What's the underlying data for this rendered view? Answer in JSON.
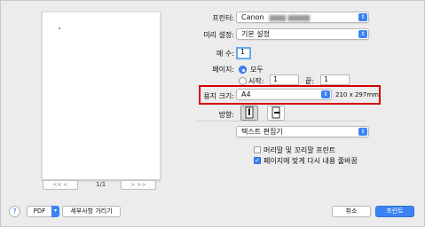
{
  "preview": {
    "page_count": "1/1"
  },
  "printer": {
    "label": "프린터:",
    "value": "Canon",
    "value_model_blurred": "▆▆▆ ▆▆▆▆"
  },
  "presets": {
    "label": "미리 설정:",
    "value": "기본 설정"
  },
  "copies": {
    "label": "매 수:",
    "value": "1"
  },
  "pages": {
    "label": "페이지:",
    "all_label": "모두",
    "from_label": "시작:",
    "from_value": "1",
    "to_label": "끝:",
    "to_value": "1"
  },
  "paper_size": {
    "label": "용지 크기:",
    "value": "A4",
    "dimensions": "210 x 297mm"
  },
  "orientation": {
    "label": "방향:"
  },
  "app_section": {
    "value": "텍스트 편집기"
  },
  "options": {
    "headers_footers": "머리말 및 꼬리말 프린트",
    "rewrap": "페이지에 맞게 다시 내용 줄바꿈"
  },
  "footer": {
    "help": "?",
    "pdf_label": "PDF",
    "hide_details": "세부사항 가리기",
    "cancel": "취소",
    "print": "프린트"
  },
  "colors": {
    "accent": "#3b83f5",
    "highlight_box": "#d40000"
  }
}
